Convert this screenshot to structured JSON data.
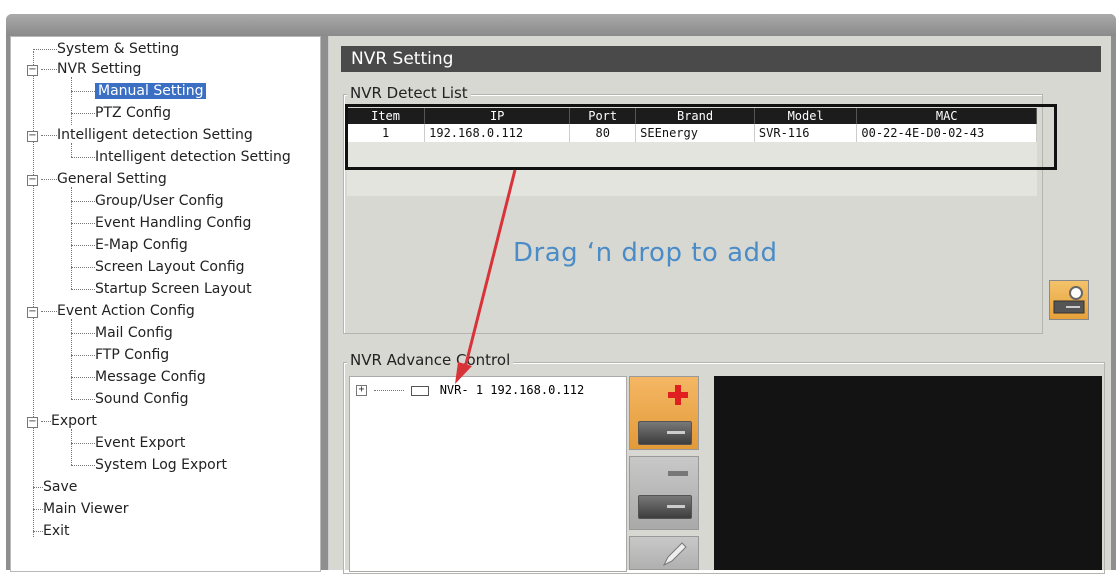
{
  "tree": {
    "items": [
      {
        "label": "System & Setting"
      },
      {
        "label": "NVR  Setting"
      },
      {
        "label": "Manual Setting"
      },
      {
        "label": "PTZ Config"
      },
      {
        "label": "Intelligent detection Setting"
      },
      {
        "label": "Intelligent detection Setting"
      },
      {
        "label": "General Setting"
      },
      {
        "label": "Group/User Config"
      },
      {
        "label": "Event Handling Config"
      },
      {
        "label": "E-Map Config"
      },
      {
        "label": "Screen Layout Config"
      },
      {
        "label": "Startup Screen Layout"
      },
      {
        "label": "Event Action Config"
      },
      {
        "label": "Mail Config"
      },
      {
        "label": "FTP Config"
      },
      {
        "label": "Message Config"
      },
      {
        "label": "Sound Config"
      },
      {
        "label": "Export"
      },
      {
        "label": "Event Export"
      },
      {
        "label": "System Log Export"
      },
      {
        "label": "Save"
      },
      {
        "label": "Main Viewer"
      },
      {
        "label": "Exit"
      }
    ],
    "expander_symbol": "−"
  },
  "panel": {
    "title": "NVR Setting",
    "detect_title": "NVR  Detect List",
    "advance_title": "NVR  Advance Control",
    "drag_hint": "Drag ‘n drop to add"
  },
  "detect_table": {
    "headers": [
      "Item",
      "IP",
      "Port",
      "Brand",
      "Model",
      "MAC"
    ],
    "rows": [
      [
        "1",
        "192.168.0.112",
        "80",
        "SEEnergy",
        "SVR-116",
        "00-22-4E-D0-02-43"
      ]
    ]
  },
  "nvr_tree": {
    "expander": "+",
    "entry": "NVR- 1 192.168.0.112"
  },
  "colors": {
    "accent_selection": "#3a6fc4",
    "arrow": "#d9333a",
    "hint": "#4a8cc8",
    "add_plus": "#e02020"
  }
}
